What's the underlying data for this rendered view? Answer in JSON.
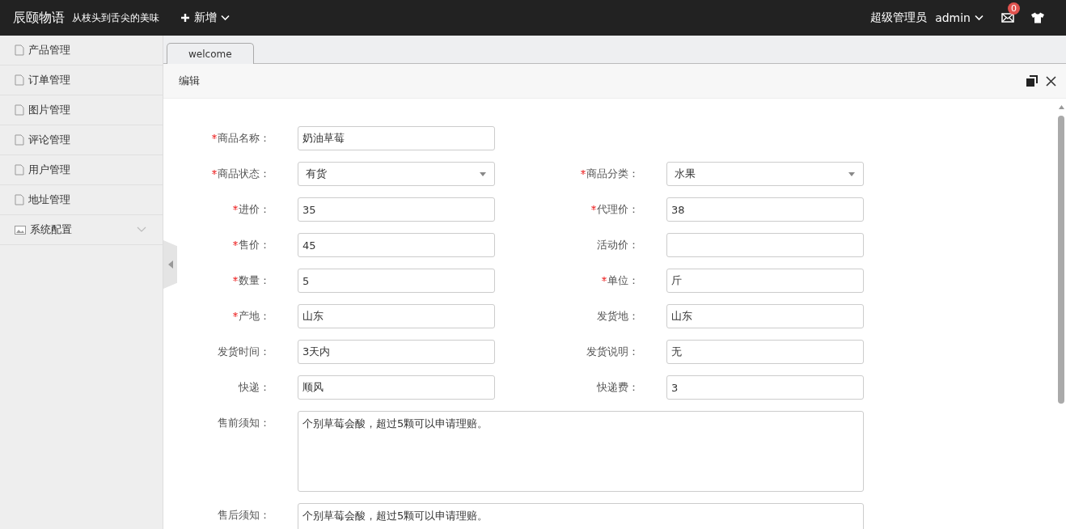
{
  "topbar": {
    "brand": "辰颐物语",
    "slogan": "从枝头到舌尖的美味",
    "new_button": "新增",
    "role": "超级管理员",
    "user": "admin",
    "mail_badge": "0"
  },
  "sidebar": {
    "items": [
      {
        "label": "产品管理",
        "kind": "page"
      },
      {
        "label": "订单管理",
        "kind": "page"
      },
      {
        "label": "图片管理",
        "kind": "page"
      },
      {
        "label": "评论管理",
        "kind": "page"
      },
      {
        "label": "用户管理",
        "kind": "page"
      },
      {
        "label": "地址管理",
        "kind": "page"
      },
      {
        "label": "系统配置",
        "kind": "group",
        "expanded": false
      }
    ]
  },
  "tabs": [
    {
      "label": "welcome",
      "selected": true
    }
  ],
  "panel": {
    "title": "编辑"
  },
  "form": {
    "rows": [
      {
        "fields": [
          {
            "label": "商品名称：",
            "required": true,
            "kind": "text",
            "value": "奶油草莓"
          }
        ]
      },
      {
        "fields": [
          {
            "label": "商品状态：",
            "required": true,
            "kind": "select",
            "value": "有货"
          },
          {
            "label": "商品分类：",
            "required": true,
            "kind": "select",
            "value": "水果"
          }
        ]
      },
      {
        "fields": [
          {
            "label": "进价：",
            "required": true,
            "kind": "text",
            "value": "35"
          },
          {
            "label": "代理价：",
            "required": true,
            "kind": "text",
            "value": "38"
          }
        ]
      },
      {
        "fields": [
          {
            "label": "售价：",
            "required": true,
            "kind": "text",
            "value": "45"
          },
          {
            "label": "活动价：",
            "required": false,
            "kind": "text"
          }
        ]
      },
      {
        "fields": [
          {
            "label": "数量：",
            "required": true,
            "kind": "text",
            "value": "5"
          },
          {
            "label": "单位：",
            "required": true,
            "kind": "text",
            "value": "斤"
          }
        ]
      },
      {
        "fields": [
          {
            "label": "产地：",
            "required": true,
            "kind": "text",
            "value": "山东"
          },
          {
            "label": "发货地：",
            "required": false,
            "kind": "text",
            "value": "山东"
          }
        ]
      },
      {
        "fields": [
          {
            "label": "发货时间：",
            "required": false,
            "kind": "text",
            "value": "3天内"
          },
          {
            "label": "发货说明：",
            "required": false,
            "kind": "text",
            "value": "无"
          }
        ]
      },
      {
        "fields": [
          {
            "label": "快递：",
            "required": false,
            "kind": "text",
            "value": "顺风"
          },
          {
            "label": "快递费：",
            "required": false,
            "kind": "text",
            "value": "3"
          }
        ]
      },
      {
        "fields": [
          {
            "label": "售前须知：",
            "required": false,
            "kind": "textarea",
            "value": "个别草莓会酸，超过5颗可以申请理赔。"
          }
        ]
      },
      {
        "fields": [
          {
            "label": "售后须知：",
            "required": false,
            "kind": "textarea",
            "value": "个别草莓会酸，超过5颗可以申请理赔。"
          }
        ]
      }
    ]
  }
}
